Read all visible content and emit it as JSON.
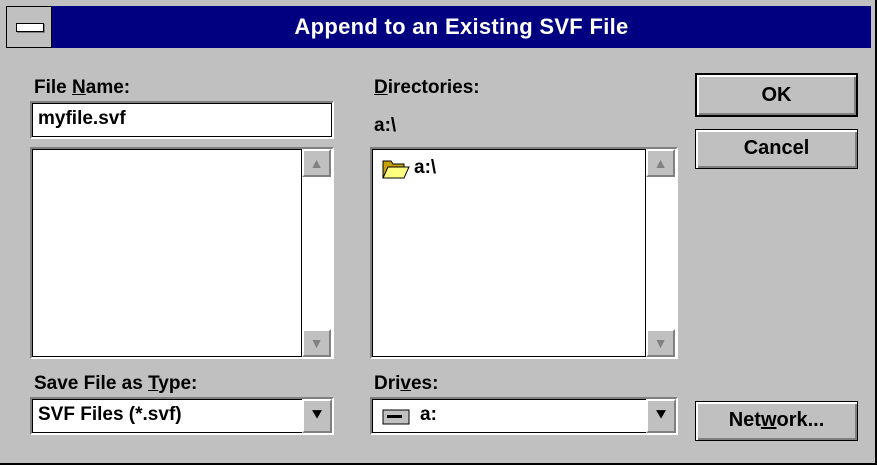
{
  "window": {
    "title": "Append to an Existing SVF File"
  },
  "file_name": {
    "label_pre": "File ",
    "label_ul": "N",
    "label_post": "ame:",
    "value": "myfile.svf"
  },
  "directories": {
    "label_ul": "D",
    "label_post": "irectories:",
    "current_path": "a:\\",
    "items": [
      "a:\\"
    ]
  },
  "save_type": {
    "label_pre": "Save File as ",
    "label_ul": "T",
    "label_post": "ype:",
    "selected": "SVF Files (*.svf)"
  },
  "drives": {
    "label_pre": "Dri",
    "label_ul": "v",
    "label_post": "es:",
    "selected": "a:"
  },
  "buttons": {
    "ok": "OK",
    "cancel": "Cancel",
    "network_pre": "Net",
    "network_ul": "w",
    "network_post": "ork..."
  },
  "icons": {
    "system_menu": "system-menu-icon",
    "folder": "open-folder-icon",
    "drive": "floppy-drive-icon",
    "scroll_up": "scroll-up-arrow-icon",
    "scroll_down": "scroll-down-arrow-icon",
    "dropdown": "dropdown-arrow-icon"
  }
}
